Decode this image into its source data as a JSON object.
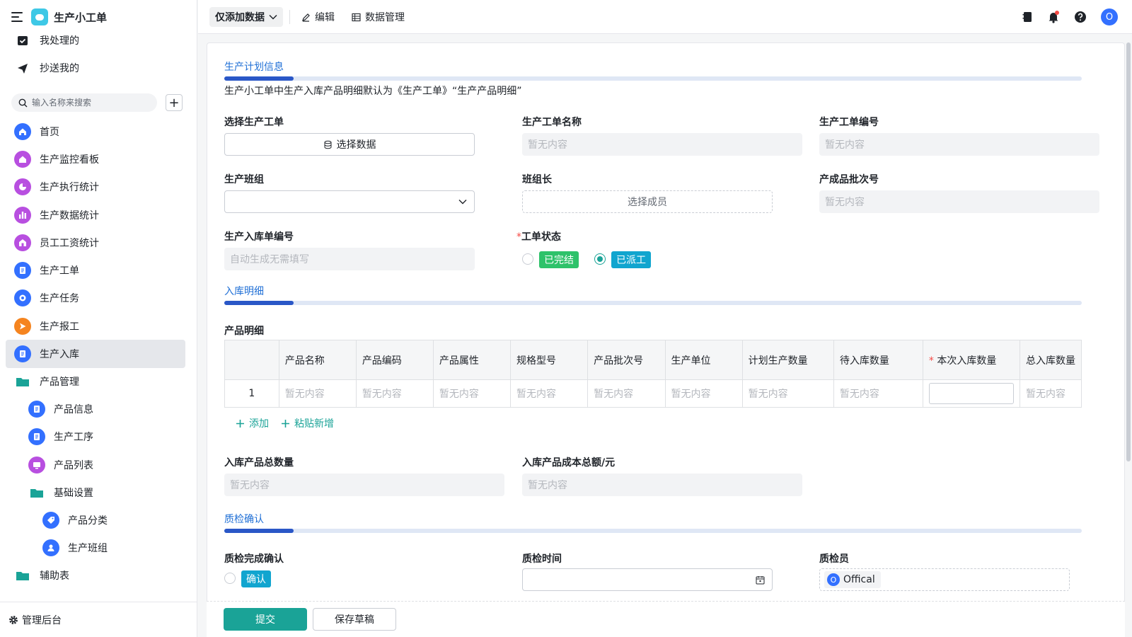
{
  "app": {
    "title": "生产小工单"
  },
  "sidebar": {
    "top_items": [
      {
        "label": "我处理的",
        "icon": "inbox-check-icon"
      },
      {
        "label": "抄送我的",
        "icon": "send-icon"
      }
    ],
    "search_placeholder": "输入名称来搜索",
    "items": [
      {
        "label": "首页",
        "icon": "home-icon",
        "color": "#3370ff"
      },
      {
        "label": "生产监控看板",
        "icon": "house-icon",
        "color": "#b84fe0"
      },
      {
        "label": "生产执行统计",
        "icon": "pie-chart-icon",
        "color": "#b84fe0"
      },
      {
        "label": "生产数据统计",
        "icon": "bar-chart-icon",
        "color": "#b84fe0"
      },
      {
        "label": "员工工资统计",
        "icon": "shop-icon",
        "color": "#b84fe0"
      },
      {
        "label": "生产工单",
        "icon": "document-icon",
        "color": "#3370ff"
      },
      {
        "label": "生产任务",
        "icon": "target-icon",
        "color": "#3370ff"
      },
      {
        "label": "生产报工",
        "icon": "arrow-right-icon",
        "color": "#f5841f"
      },
      {
        "label": "生产入库",
        "icon": "document-icon",
        "color": "#3370ff"
      },
      {
        "label": "产品管理",
        "icon": "folder-icon",
        "color": "#1aa397"
      },
      {
        "label": "产品信息",
        "icon": "document-icon",
        "color": "#3370ff"
      },
      {
        "label": "生产工序",
        "icon": "document-icon",
        "color": "#3370ff"
      },
      {
        "label": "产品列表",
        "icon": "monitor-icon",
        "color": "#b84fe0"
      },
      {
        "label": "基础设置",
        "icon": "folder-icon",
        "color": "#1aa397"
      },
      {
        "label": "产品分类",
        "icon": "tag-icon",
        "color": "#3370ff"
      },
      {
        "label": "生产班组",
        "icon": "person-icon",
        "color": "#3370ff"
      },
      {
        "label": "辅助表",
        "icon": "folder-icon",
        "color": "#1aa397"
      }
    ],
    "bottom_label": "管理后台"
  },
  "topbar": {
    "view_label": "仅添加数据",
    "edit_label": "编辑",
    "data_label": "数据管理",
    "user_initial": "O"
  },
  "form": {
    "section1": {
      "title": "生产计划信息",
      "note": "生产小工单中生产入库产品明细默认为《生产工单》“生产产品明细”"
    },
    "f_order": {
      "label": "选择生产工单",
      "button": "选择数据"
    },
    "f_order_name": {
      "label": "生产工单名称",
      "value": "暂无内容"
    },
    "f_order_no": {
      "label": "生产工单编号",
      "value": "暂无内容"
    },
    "f_team": {
      "label": "生产班组"
    },
    "f_leader": {
      "label": "班组长",
      "button": "选择成员"
    },
    "f_batch": {
      "label": "产成品批次号",
      "value": "暂无内容"
    },
    "f_in_no": {
      "label": "生产入库单编号",
      "value": "自动生成无需填写"
    },
    "f_status": {
      "label": "工单状态",
      "req": "*",
      "opt1": "已完结",
      "opt2": "已派工",
      "opt1_color": "#2ec26a",
      "opt2_color": "#11a5cf"
    },
    "section2": {
      "title": "入库明细"
    },
    "detail_label": "产品明细",
    "table": {
      "headers": [
        "产品名称",
        "产品编码",
        "产品属性",
        "规格型号",
        "产品批次号",
        "生产单位",
        "计划生产数量",
        "待入库数量",
        "本次入库数量",
        "总入库数量"
      ],
      "req_mark": "*",
      "row_index": "1",
      "empty": "暂无内容"
    },
    "add_label": "添加",
    "paste_label": "粘贴新增",
    "f_total_qty": {
      "label": "入库产品总数量",
      "value": "暂无内容"
    },
    "f_total_cost": {
      "label": "入库产品成本总额/元",
      "value": "暂无内容"
    },
    "section3": {
      "title": "质检确认"
    },
    "f_qc": {
      "label": "质检完成确认",
      "option": "确认"
    },
    "f_qc_time": {
      "label": "质检时间"
    },
    "f_qc_person": {
      "label": "质检员",
      "member": "Offical",
      "initial": "O"
    }
  },
  "footer": {
    "submit": "提交",
    "draft": "保存草稿"
  }
}
